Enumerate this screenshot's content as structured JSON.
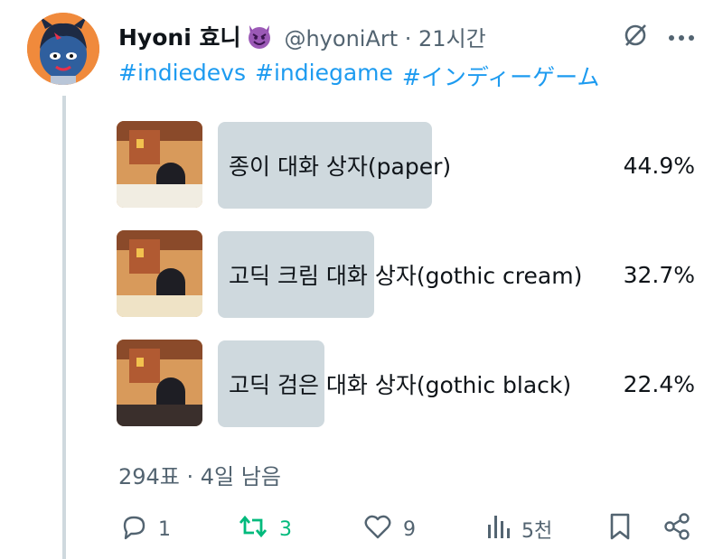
{
  "user": {
    "name": "Hyoni 효니",
    "handle_time": "@hyoniArt · 21시간"
  },
  "hashtags": [
    "#indiedevs",
    "#indiegame",
    "#インディーゲーム"
  ],
  "poll": {
    "options": [
      {
        "label": "종이 대화 상자(paper)",
        "percent": "44.9%",
        "fraction": 0.449
      },
      {
        "label": "고딕 크림 대화 상자(gothic cream)",
        "percent": "32.7%",
        "fraction": 0.327
      },
      {
        "label": "고딕 검은 대화 상자(gothic black)",
        "percent": "22.4%",
        "fraction": 0.224
      }
    ],
    "meta": "294표 · 4일 남음"
  },
  "actions": {
    "replies": "1",
    "reposts": "3",
    "likes": "9",
    "views": "5천"
  },
  "colors": {
    "accent": "#1d9bf0",
    "repost_active": "#00ba7c",
    "bar": "#cfd9de",
    "muted": "#536471"
  },
  "icons": [
    "devil-emoji-icon",
    "grok-icon",
    "more-icon",
    "reply-icon",
    "repost-icon",
    "like-icon",
    "views-icon",
    "bookmark-icon",
    "share-icon"
  ]
}
